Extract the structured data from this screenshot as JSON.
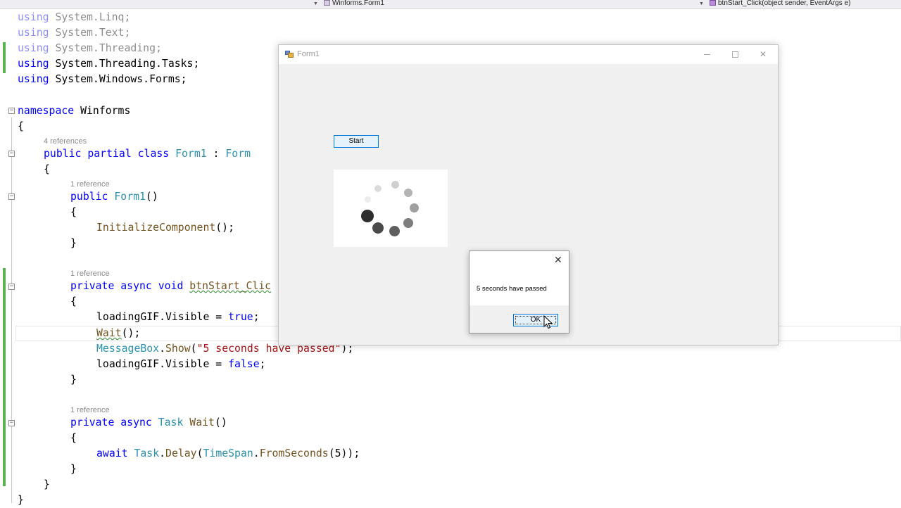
{
  "navbar": {
    "project": "Winforms.Form1",
    "member": "btnStart_Click(object sender, EventArgs e)"
  },
  "code": {
    "line1_kw": "using",
    "line1_ns": "System.Linq;",
    "line2_kw": "using",
    "line2_ns": "System.Text;",
    "line3_kw": "using",
    "line3_ns": "System.Threading;",
    "line4_kw": "using",
    "line4_ns": "System.Threading.Tasks;",
    "line5_kw": "using",
    "line5_ns": "System.Windows.Forms;",
    "ns_kw": "namespace",
    "ns_name": "Winforms",
    "open_brace": "{",
    "close_brace": "}",
    "class_refs": "4 references",
    "class_kw": "public partial class",
    "class_name": "Form1",
    "class_sep": " : ",
    "class_base": "Form",
    "ctor_refs": "1 reference",
    "ctor_kw": "public",
    "ctor_name": "Form1",
    "ctor_parens": "()",
    "init_call": "InitializeComponent",
    "init_tail": "();",
    "click_refs": "1 reference",
    "click_kw": "private async void",
    "click_name": "btnStart_Clic",
    "gif_true_pre": "loadingGIF.Visible = ",
    "kw_true": "true",
    "semicolon": ";",
    "wait_call": "Wait",
    "wait_tail": "();",
    "msgbox_type": "MessageBox",
    "msgbox_dot": ".",
    "msgbox_method": "Show",
    "msgbox_open": "(",
    "msgbox_str": "\"5 seconds have passed\"",
    "msgbox_close": ");",
    "gif_false_pre": "loadingGIF.Visible = ",
    "kw_false": "false",
    "wait_refs": "1 reference",
    "wait_kw": "private async",
    "wait_type": "Task",
    "wait_name": "Wait",
    "wait_parens": "()",
    "await_kw": "await",
    "task_type": "Task",
    "delay_dot": ".",
    "delay_method": "Delay",
    "delay_open": "(",
    "timespan_type": "TimeSpan",
    "from_dot": ".",
    "from_method": "FromSeconds",
    "delay_args": "(5));"
  },
  "form": {
    "title": "Form1",
    "start_label": "Start"
  },
  "messagebox": {
    "text": "5 seconds have passed",
    "ok_label": "OK",
    "close_glyph": "✕"
  },
  "colors": {
    "keyword": "#0000ff",
    "type": "#2b91af",
    "string": "#a31515",
    "method": "#74531f",
    "change_bar": "#57b34f",
    "button_border": "#0078d7"
  }
}
